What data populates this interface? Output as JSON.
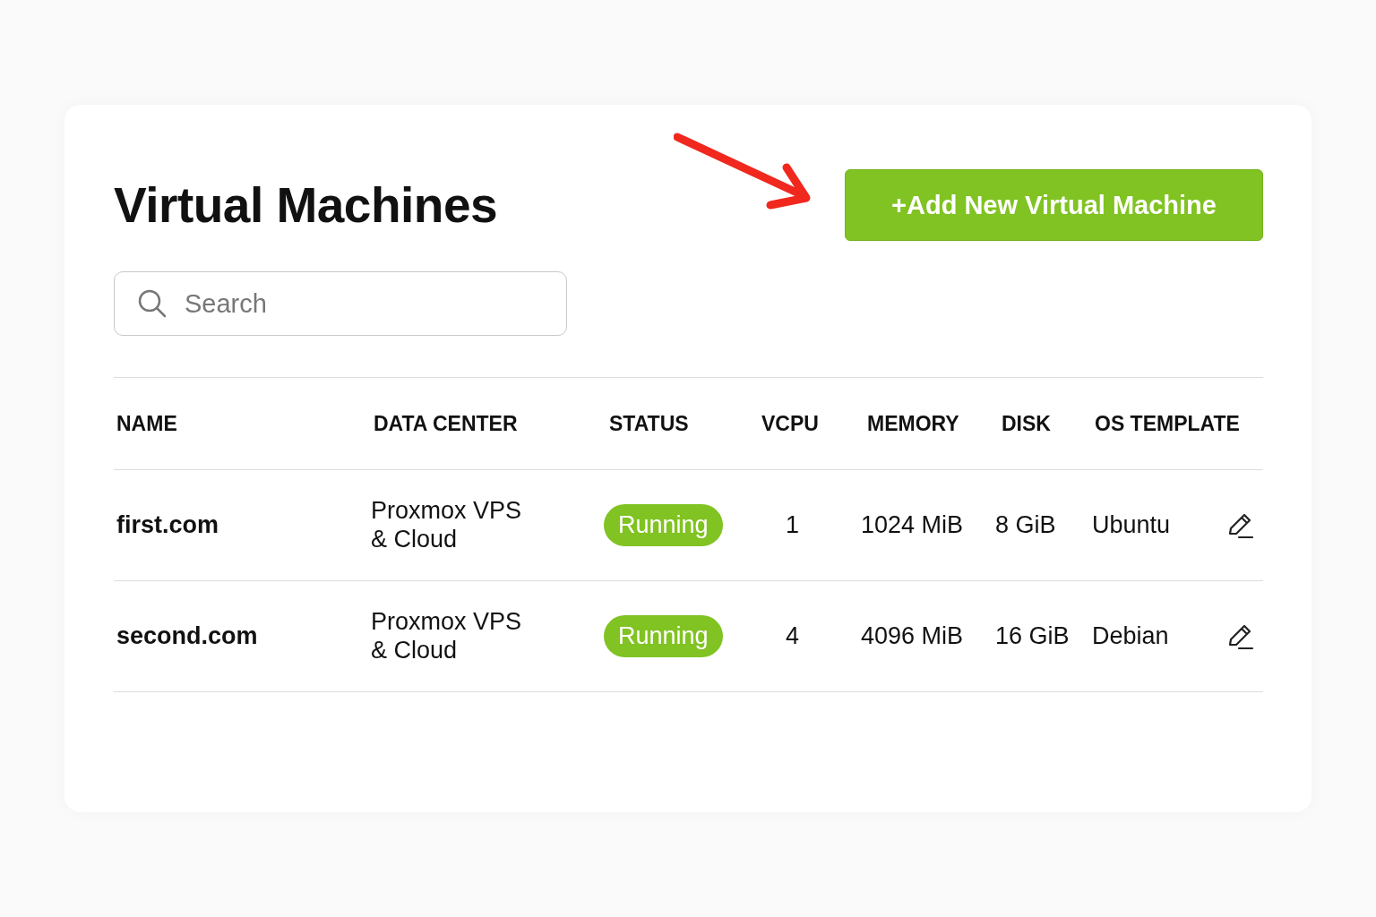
{
  "page": {
    "title": "Virtual Machines"
  },
  "add_button": {
    "label": "+Add New Virtual Machine"
  },
  "search": {
    "placeholder": "Search"
  },
  "table": {
    "columns": [
      "NAME",
      "DATA CENTER",
      "STATUS",
      "VCPU",
      "MEMORY",
      "DISK",
      "OS TEMPLATE"
    ],
    "rows": [
      {
        "name": "first.com",
        "data_center": "Proxmox VPS & Cloud",
        "status": "Running",
        "vcpu": "1",
        "memory": "1024 MiB",
        "disk": "8 GiB",
        "os_template": "Ubuntu"
      },
      {
        "name": "second.com",
        "data_center": "Proxmox VPS & Cloud",
        "status": "Running",
        "vcpu": "4",
        "memory": "4096 MiB",
        "disk": "16 GiB",
        "os_template": "Debian"
      }
    ]
  }
}
